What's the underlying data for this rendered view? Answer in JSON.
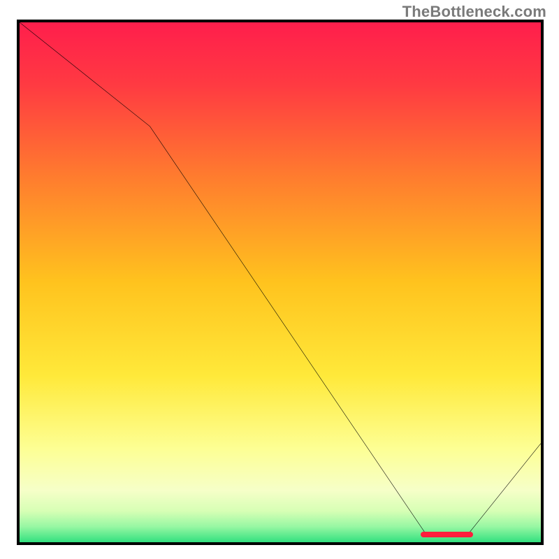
{
  "watermark": "TheBottleneck.com",
  "chart_data": {
    "type": "line",
    "title": "",
    "xlabel": "",
    "ylabel": "",
    "xlim": [
      0,
      100
    ],
    "ylim": [
      0,
      100
    ],
    "grid": false,
    "gradient_stops": [
      {
        "pct": 0,
        "color": "#ff1e4c"
      },
      {
        "pct": 12,
        "color": "#ff3a42"
      },
      {
        "pct": 30,
        "color": "#ff7d2e"
      },
      {
        "pct": 50,
        "color": "#ffc31e"
      },
      {
        "pct": 68,
        "color": "#ffe93a"
      },
      {
        "pct": 82,
        "color": "#fdff94"
      },
      {
        "pct": 90,
        "color": "#f6ffc8"
      },
      {
        "pct": 94,
        "color": "#d7ffb5"
      },
      {
        "pct": 97,
        "color": "#97f7a3"
      },
      {
        "pct": 100,
        "color": "#32e07f"
      }
    ],
    "curve_points": [
      {
        "x": 0,
        "y": 100
      },
      {
        "x": 25,
        "y": 80
      },
      {
        "x": 78,
        "y": 1.5
      },
      {
        "x": 86,
        "y": 1.5
      },
      {
        "x": 100,
        "y": 19
      }
    ],
    "bottleneck_marker": {
      "x_start": 77,
      "x_end": 87,
      "y": 1.5
    }
  }
}
